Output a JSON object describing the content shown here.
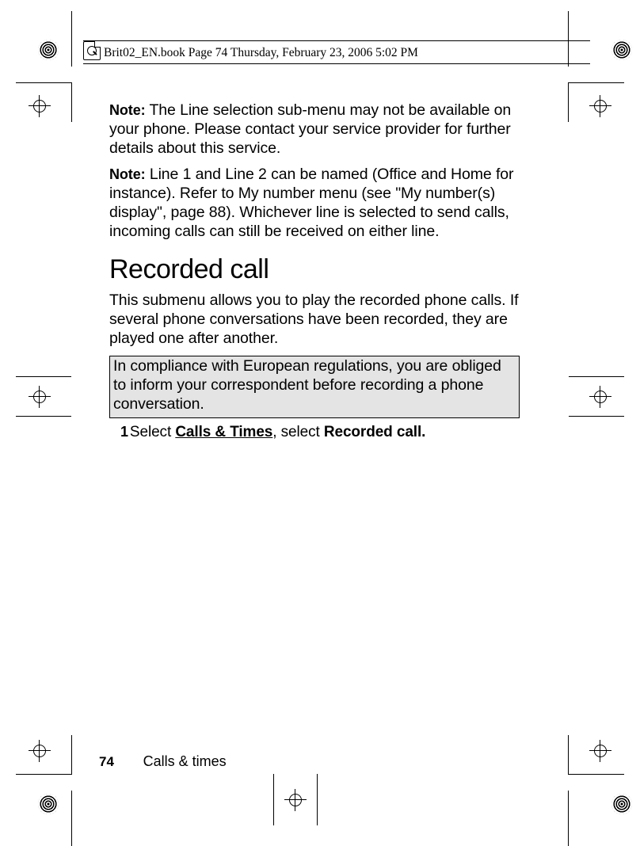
{
  "header": {
    "running": "Brit02_EN.book  Page 74  Thursday, February 23, 2006  5:02 PM"
  },
  "body": {
    "note1_label": "Note:",
    "note1_text": " The Line selection sub-menu may not be available on your phone. Please contact your service provider for further details about this service.",
    "note2_label": "Note:",
    "note2_text": "  Line 1 and Line 2 can be named (Office and Home for instance). Refer to My number menu (see \"My number(s) display\", page 88). Whichever line is selected to send calls, incoming calls can still be received on either line.",
    "heading": "Recorded call",
    "intro": "This submenu allows you to play the recorded phone calls. If several phone conversations have been recorded, they are played one after another.",
    "boxed": "In compliance with European regulations, you are obliged to inform your correspondent before recording a phone conversation.",
    "step_num": "1",
    "step_a": "Select ",
    "step_menu1": "Calls & Times",
    "step_b": ", select ",
    "step_menu2": "Recorded call."
  },
  "footer": {
    "page": "74",
    "chapter": "Calls & times"
  }
}
